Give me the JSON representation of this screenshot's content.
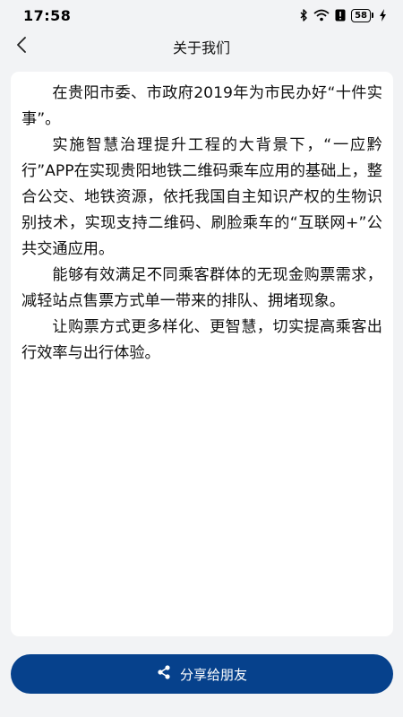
{
  "status_bar": {
    "time": "17:58",
    "battery": "58",
    "icons": [
      "bluetooth-icon",
      "wifi-icon",
      "alert-icon",
      "battery-icon",
      "charging-icon"
    ]
  },
  "header": {
    "title": "关于我们",
    "back_icon": "chevron-left-icon"
  },
  "content": {
    "paragraphs": [
      "在贵阳市委、市政府2019年为市民办好“十件实事”。",
      "实施智慧治理提升工程的大背景下，“一应黔行”APP在实现贵阳地铁二维码乘车应用的基础上，整合公交、地铁资源，依托我国自主知识产权的生物识别技术，实现支持二维码、刷脸乘车的“互联网+”公共交通应用。",
      "能够有效满足不同乘客群体的无现金购票需求，减轻站点售票方式单一带来的排队、拥堵现象。",
      "让购票方式更多样化、更智慧，切实提高乘客出行效率与出行体验。"
    ]
  },
  "share_button": {
    "label": "分享给朋友",
    "icon": "share-icon"
  },
  "colors": {
    "background": "#f2f3f5",
    "card": "#ffffff",
    "primary_button": "#06418c"
  }
}
